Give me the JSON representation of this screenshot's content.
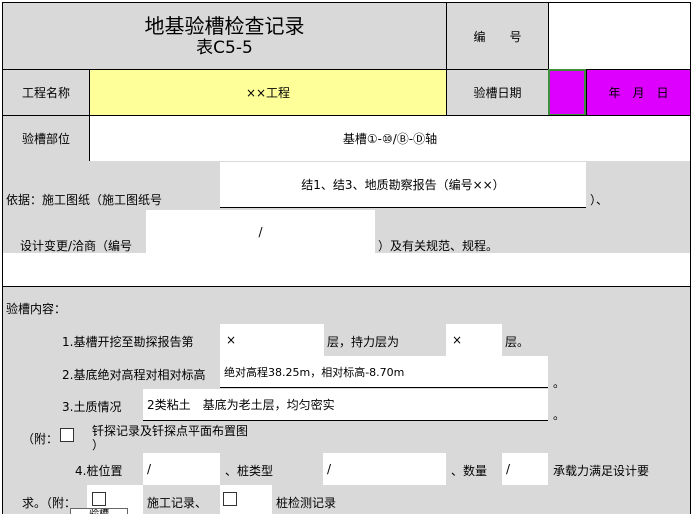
{
  "header": {
    "title": "地基验槽检查记录",
    "table_no": "表C5-5",
    "number_label": "编　　号",
    "number_value": ""
  },
  "project": {
    "name_label": "工程名称",
    "name_value": "××工程",
    "date_label": "验槽日期",
    "date_value": "",
    "date_units": "年　月　日"
  },
  "location": {
    "label": "验槽部位",
    "value": "基槽①-⑩/Ⓑ-Ⓓ轴"
  },
  "basis": {
    "line1_prefix": "依据：施工图纸（施工图纸号",
    "line1_value": "结1、结3、地质勘察报告（编号××）",
    "line1_suffix": "）、",
    "line2_prefix": "设计变更/洽商（编号",
    "line2_value": "/",
    "line2_suffix": "）及有关规范、规程。"
  },
  "content": {
    "heading": "验槽内容：",
    "item1_prefix": "1.基槽开挖至勘探报告第",
    "item1_value1": "×",
    "item1_mid": "层，持力层为",
    "item1_value2": "×",
    "item1_suffix": "层。",
    "item2_prefix": "2.基底绝对高程对相对标高",
    "item2_value": "绝对高程38.25m，相对标高-8.70m",
    "item2_suffix": "。",
    "item3_prefix": "3.土质情况",
    "item3_value": "2类粘土　基底为老土层，均匀密实",
    "item3_suffix": "。",
    "attach1_prefix": "（附：",
    "attach1_text": "钎探记录及钎探点平面布置图",
    "attach1_close": "）",
    "item4_prefix": "4.桩位置",
    "item4_value1": "/",
    "item4_type_label": "、桩类型",
    "item4_value2": "/",
    "item4_count_label": "、数量",
    "item4_value3": "/",
    "item4_suffix": "承载力满足设计要",
    "line5_prefix": "求。（附：",
    "line5_opt1": "施工记录、",
    "line5_opt2": "桩检测记录"
  },
  "sheet_tab": {
    "label": "验槽"
  },
  "colors": {
    "gray": "#d9d9d9",
    "yellow": "#ffff99",
    "magenta": "#dd00ff",
    "selected_border": "#3f8f3f"
  }
}
